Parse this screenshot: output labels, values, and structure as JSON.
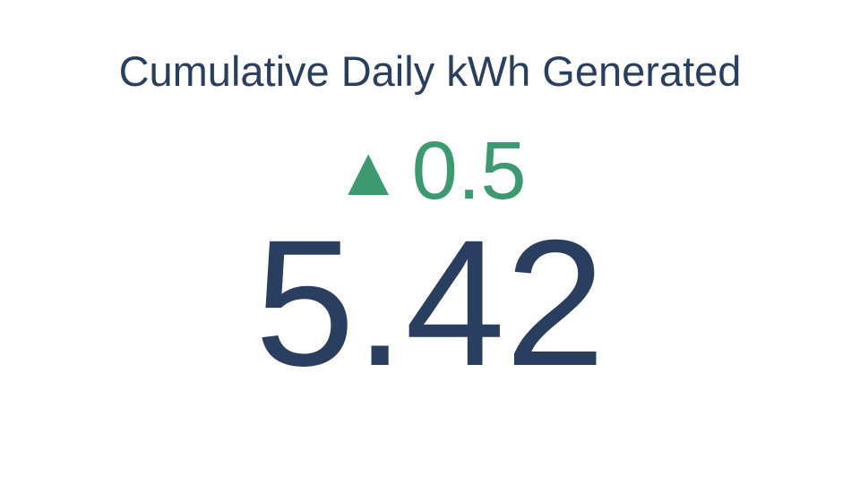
{
  "chart_data": {
    "type": "indicator",
    "title": "Cumulative Daily kWh Generated",
    "value": 5.42,
    "value_text": "5.42",
    "delta": {
      "direction": "increasing",
      "arrow": "▲",
      "value": 0.5,
      "value_text": "0.5",
      "color": "#3d9970"
    },
    "value_color": "#2a3f5f",
    "title_color": "#2a3f5f"
  }
}
